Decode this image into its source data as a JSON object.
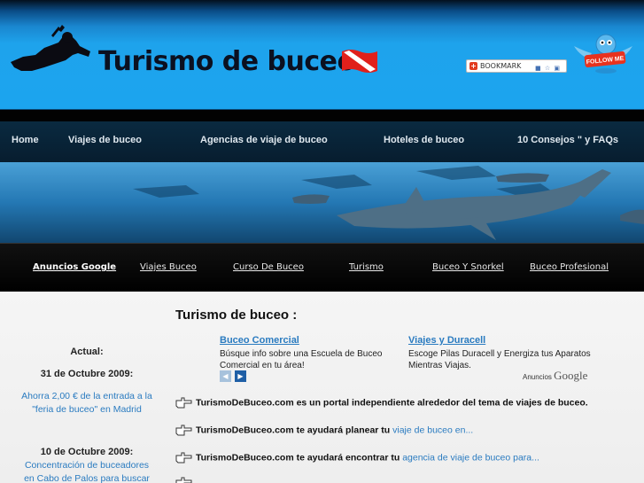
{
  "header": {
    "title": "Turismo de buceo",
    "bookmark_label": "BOOKMARK",
    "bookmark_extra": "■ ☆ ▣",
    "twitter_label": "FOLLOW ME"
  },
  "nav": [
    {
      "label": "Home"
    },
    {
      "label": "Viajes de buceo"
    },
    {
      "label": "Agencias de viaje de buceo"
    },
    {
      "label": "Hoteles de buceo"
    },
    {
      "label": "10 Consejos \" y FAQs"
    }
  ],
  "adbar": [
    {
      "label": "Anuncios Google"
    },
    {
      "label": "Viajes Buceo"
    },
    {
      "label": "Curso De Buceo"
    },
    {
      "label": "Turismo"
    },
    {
      "label": "Buceo Y Snorkel"
    },
    {
      "label": "Buceo Profesional"
    }
  ],
  "sidebar": {
    "heading": "Actual:",
    "news": [
      {
        "date": "31 de Octubre 2009:",
        "text": "Ahorra 2,00 € de la entrada a la \"feria de buceo\" en Madrid"
      },
      {
        "date": "10 de Octubre 2009:",
        "text": "Concentración de buceadores en Cabo de Palos para buscar su"
      }
    ]
  },
  "main": {
    "title": "Turismo de buceo :",
    "ads": [
      {
        "title": "Buceo Comercial",
        "text": "Búsque info sobre una Escuela de Buceo Comercial en tu área!"
      },
      {
        "title": "Viajes y Duracell",
        "text": "Escoge Pilas Duracell y Energiza tus Aparatos Mientras Viajas."
      }
    ],
    "ads_by": "Anuncios",
    "ads_by_brand": "Google",
    "lines": [
      {
        "bold": "TurismoDeBuceo.com es un portal independiente alrededor del tema de viajes de buceo.",
        "link": ""
      },
      {
        "bold": "TurismoDeBuceo.com te ayudará planear tu",
        "link": "viaje de buceo en..."
      },
      {
        "bold": "TurismoDeBuceo.com te ayudará encontrar tu",
        "link": "agencia de viaje de buceo para..."
      }
    ]
  },
  "colors": {
    "header_blue": "#1ca4ef",
    "link_blue": "#2a7bc0",
    "nav_bg": "#071d2f"
  }
}
